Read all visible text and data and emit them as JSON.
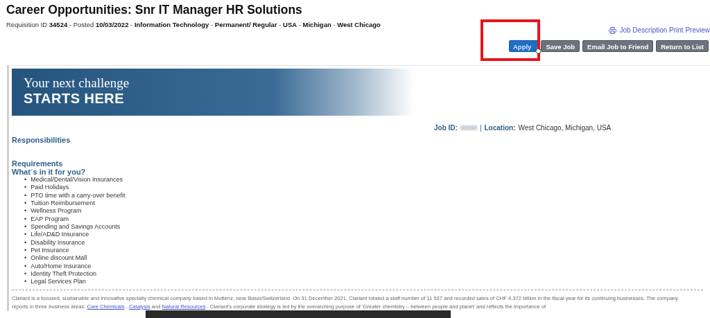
{
  "header": {
    "title": "Career Opportunities: Snr IT Manager HR Solutions",
    "meta_separator": "-",
    "meta": [
      {
        "label": "Requisition ID",
        "value": "34524"
      },
      {
        "label": "Posted",
        "value": "10/03/2022"
      },
      {
        "value": "Information Technology"
      },
      {
        "value": "Permanent/ Regular"
      },
      {
        "value": "USA"
      },
      {
        "value": "Michigan"
      },
      {
        "value": "West Chicago"
      }
    ]
  },
  "print_link": "Job Description Print Preview",
  "buttons": [
    {
      "label": "Apply",
      "kind": "primary",
      "highlighted": true
    },
    {
      "label": "Save Job",
      "kind": "secondary",
      "highlighted": false
    },
    {
      "label": "Email Job to Friend",
      "kind": "secondary",
      "highlighted": false
    },
    {
      "label": "Return to List",
      "kind": "secondary",
      "highlighted": false
    }
  ],
  "banner": {
    "line_1": "Your next challenge",
    "line_2": "STARTS HERE"
  },
  "job_info": {
    "id_label": "Job ID:",
    "separator": "|",
    "location_label": "Location:",
    "location": "West Chicago, Michigan, USA"
  },
  "sections": [
    "Responsibilities",
    "Requirements",
    "What´s in it for you?"
  ],
  "bullet": "•",
  "benefits": [
    "Medical/Dental/Vision Insurances",
    "Paid Holidays",
    "PTO time with a carry-over benefit",
    "Tuition Reimbursement",
    "Wellness Program",
    "EAP Program",
    "Spending and Savings Accounts",
    "Life/AD&D Insurance",
    "Disability Insurance",
    "Pet Insurance",
    "Online discount Mall",
    "Auto/Home Insurance",
    "Identity Theft Protection",
    "Legal Services Plan"
  ],
  "about": [
    {
      "kind": "text",
      "text": "Clariant is a focused, sustainable and innovative specialty chemical company based in Muttenz, near Basel/Switzerland. On 31 December 2021, Clariant totaled a staff number of 11 537 and recorded sales of CHF 4.372 billion in the fiscal year for its continuing businesses. The company reports in three business areas:"
    },
    {
      "kind": "link",
      "text": "Care Chemicals"
    },
    {
      "kind": "text",
      "text": ","
    },
    {
      "kind": "link",
      "text": "Catalysis"
    },
    {
      "kind": "text",
      "text": "and"
    },
    {
      "kind": "link",
      "text": "Natural Resources"
    },
    {
      "kind": "text",
      "text": ". Clariant's corporate strategy is led by the overarching purpose of 'Greater chemistry – between people and planet' and reflects the importance of"
    }
  ]
}
